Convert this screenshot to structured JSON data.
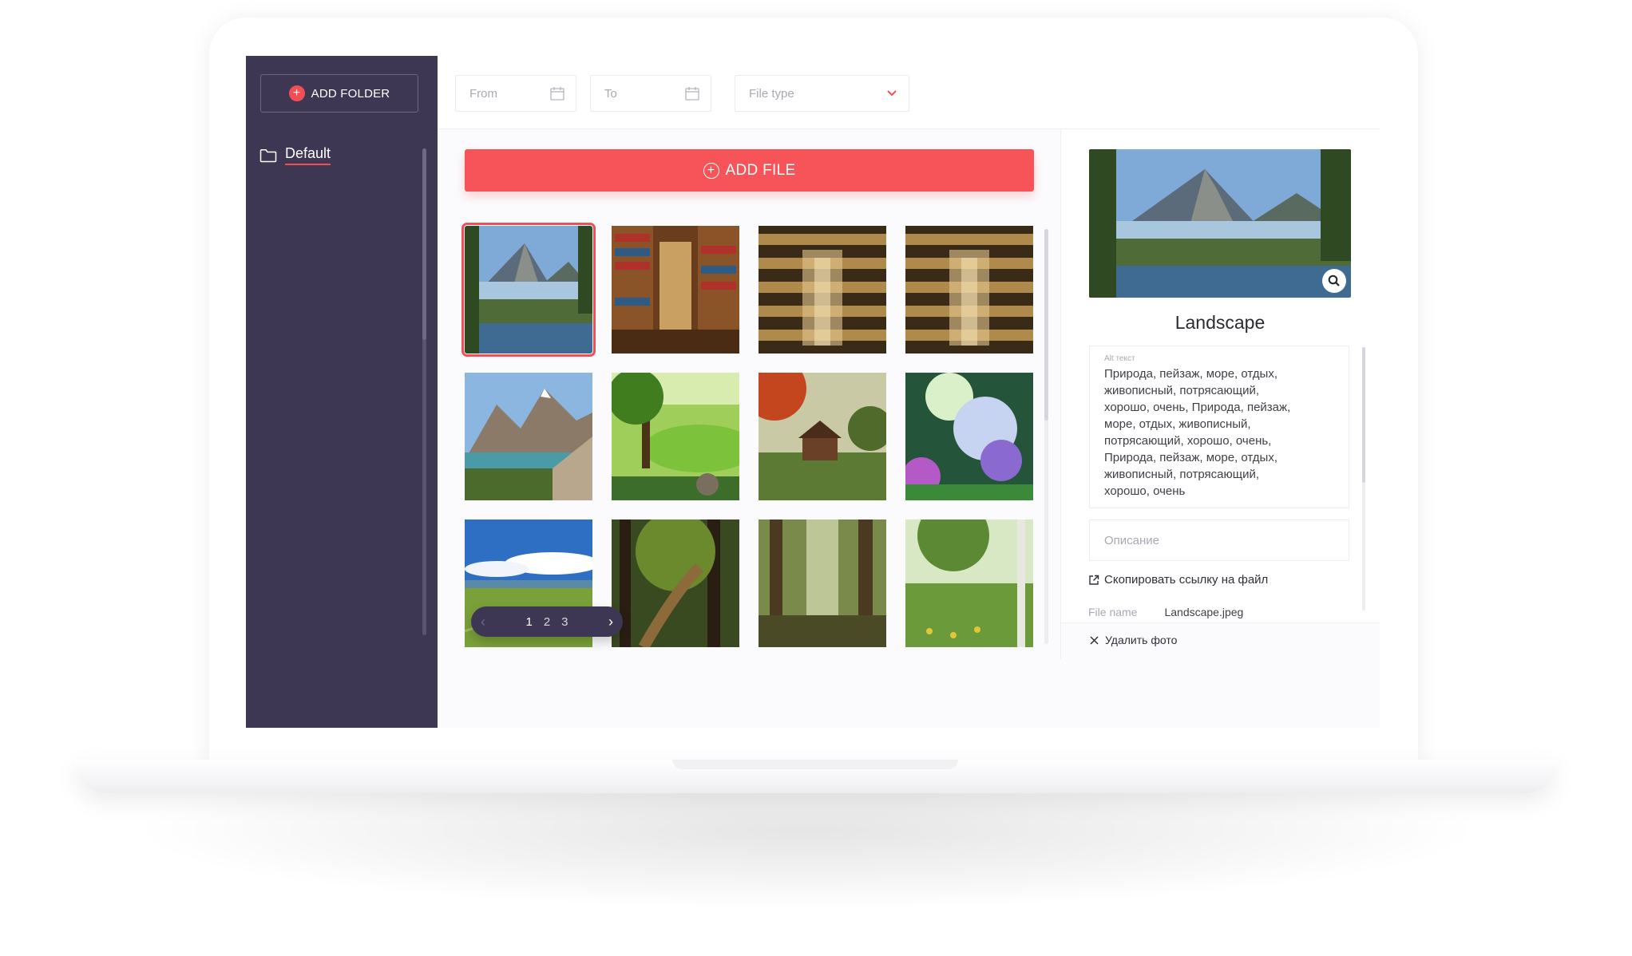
{
  "sidebar": {
    "add_folder_label": "ADD FOLDER",
    "folders": [
      {
        "label": "Default",
        "active": true
      }
    ]
  },
  "filters": {
    "from_placeholder": "From",
    "to_placeholder": "To",
    "file_type_placeholder": "File type"
  },
  "gallery": {
    "add_file_label": "ADD FILE",
    "images": [
      {
        "title": "mountain-lake",
        "selected": true
      },
      {
        "title": "library-stacks"
      },
      {
        "title": "bookstore-shelves"
      },
      {
        "title": "bookstore-shelves"
      },
      {
        "title": "rocky-mountains-lake"
      },
      {
        "title": "green-meadow-trees"
      },
      {
        "title": "autumn-farm-house"
      },
      {
        "title": "blossom-forest"
      },
      {
        "title": "blue-sky-field"
      },
      {
        "title": "forest-path"
      },
      {
        "title": "misty-forest"
      },
      {
        "title": "birch-meadow"
      }
    ],
    "pagination": {
      "pages": [
        "1",
        "2",
        "3"
      ],
      "current": "1"
    }
  },
  "detail": {
    "title": "Landscape",
    "alt_label": "Alt текст",
    "alt_text": "Природа, пейзаж, море, отдых,\nживописный, потрясающий,\nхорошо, очень, Природа, пейзаж,\nморе, отдых,  живописный,\nпотрясающий, хорошо, очень,\nПрирода, пейзаж, море, отдых,\nживописный, потрясающий,\nхорошо, очень",
    "description_placeholder": "Описание",
    "copy_link_label": "Скопировать ссылку на файл",
    "file_name_key": "File name",
    "file_name_value": "Landscape.jpeg",
    "delete_label": "Удалить фото"
  },
  "colors": {
    "sidebar_bg": "#3e3754",
    "accent": "#f65458"
  }
}
